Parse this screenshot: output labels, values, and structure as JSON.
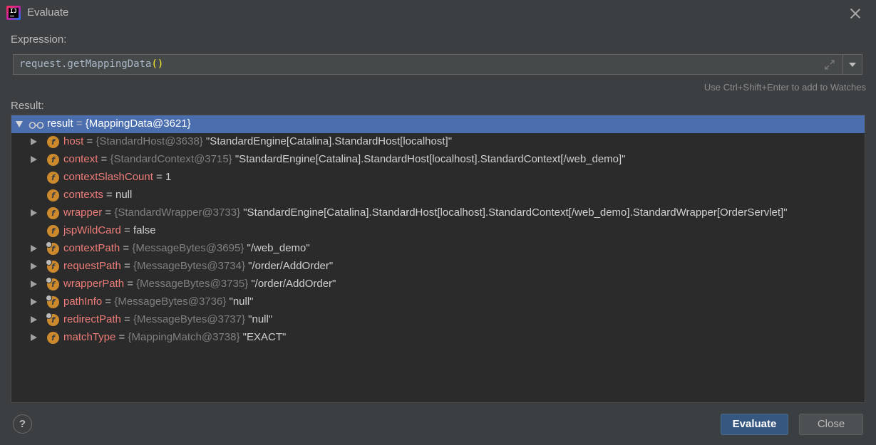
{
  "window": {
    "title": "Evaluate",
    "app_icon": "intellij-idea-icon",
    "close_icon": "close-icon"
  },
  "expression": {
    "label": "Expression:",
    "code": "request.getMappingData",
    "parens": "()",
    "hint": "Use Ctrl+Shift+Enter to add to Watches"
  },
  "result": {
    "label": "Result:",
    "root": {
      "name": "result",
      "eq": " = ",
      "value": "{MappingData@3621}",
      "expanded": true,
      "selected": true
    },
    "children": [
      {
        "name": "host",
        "eq": " = ",
        "type": "{StandardHost@3638}",
        "value": "\"StandardEngine[Catalina].StandardHost[localhost]\"",
        "expandable": true,
        "locked": false
      },
      {
        "name": "context",
        "eq": " = ",
        "type": "{StandardContext@3715}",
        "value": "\"StandardEngine[Catalina].StandardHost[localhost].StandardContext[/web_demo]\"",
        "expandable": true,
        "locked": false
      },
      {
        "name": "contextSlashCount",
        "eq": " = ",
        "type": "",
        "value": "1",
        "expandable": false,
        "locked": false
      },
      {
        "name": "contexts",
        "eq": " = ",
        "type": "",
        "value": "null",
        "expandable": false,
        "locked": false
      },
      {
        "name": "wrapper",
        "eq": " = ",
        "type": "{StandardWrapper@3733}",
        "value": "\"StandardEngine[Catalina].StandardHost[localhost].StandardContext[/web_demo].StandardWrapper[OrderServlet]\"",
        "expandable": true,
        "locked": false
      },
      {
        "name": "jspWildCard",
        "eq": " = ",
        "type": "",
        "value": "false",
        "expandable": false,
        "locked": false
      },
      {
        "name": "contextPath",
        "eq": " = ",
        "type": "{MessageBytes@3695}",
        "value": "\"/web_demo\"",
        "expandable": true,
        "locked": true
      },
      {
        "name": "requestPath",
        "eq": " = ",
        "type": "{MessageBytes@3734}",
        "value": "\"/order/AddOrder\"",
        "expandable": true,
        "locked": true
      },
      {
        "name": "wrapperPath",
        "eq": " = ",
        "type": "{MessageBytes@3735}",
        "value": "\"/order/AddOrder\"",
        "expandable": true,
        "locked": true
      },
      {
        "name": "pathInfo",
        "eq": " = ",
        "type": "{MessageBytes@3736}",
        "value": "\"null\"",
        "expandable": true,
        "locked": true
      },
      {
        "name": "redirectPath",
        "eq": " = ",
        "type": "{MessageBytes@3737}",
        "value": "\"null\"",
        "expandable": true,
        "locked": true
      },
      {
        "name": "matchType",
        "eq": " = ",
        "type": "{MappingMatch@3738}",
        "value": "\"EXACT\"",
        "expandable": true,
        "locked": false
      }
    ]
  },
  "buttons": {
    "help": "?",
    "evaluate": "Evaluate",
    "close": "Close"
  },
  "colors": {
    "background": "#3c3f41",
    "tree_background": "#2b2b2b",
    "selection": "#4b6eaf",
    "field_name": "#ee7d79",
    "type_text": "#808080",
    "primary_button": "#365880",
    "field_icon": "#cc8a2d"
  }
}
